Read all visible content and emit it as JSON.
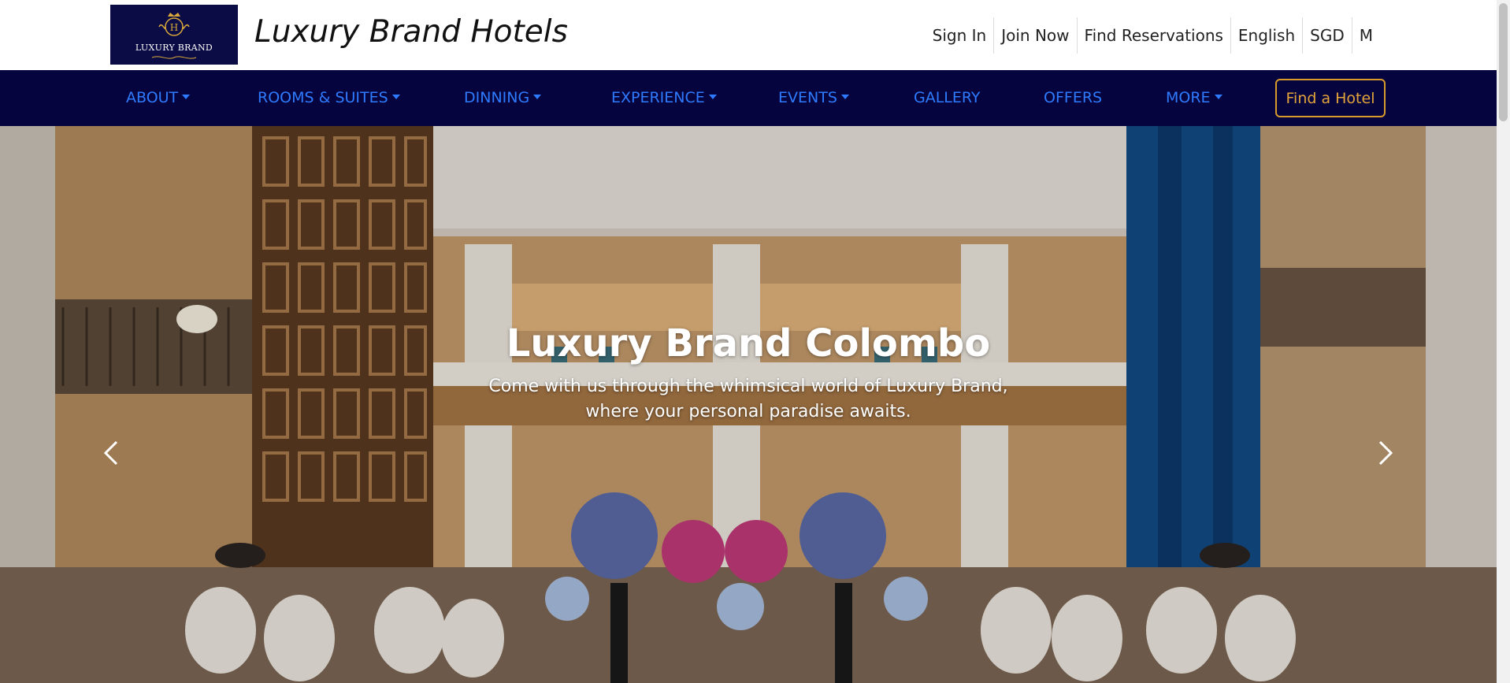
{
  "brand": {
    "logo_text": "LUXURY BRAND",
    "logo_initial": "H",
    "title": "Luxury Brand Hotels",
    "color_navy": "#05043f",
    "color_gold": "#d89b2a"
  },
  "utility_nav": [
    {
      "label": "Sign In"
    },
    {
      "label": "Join Now"
    },
    {
      "label": "Find Reservations"
    },
    {
      "label": "English"
    },
    {
      "label": "SGD"
    },
    {
      "label": "M"
    }
  ],
  "main_nav": [
    {
      "label": "ABOUT",
      "dropdown": true
    },
    {
      "label": "ROOMS & SUITES",
      "dropdown": true
    },
    {
      "label": "DINNING",
      "dropdown": true
    },
    {
      "label": "EXPERIENCE",
      "dropdown": true
    },
    {
      "label": "EVENTS",
      "dropdown": true
    },
    {
      "label": "GALLERY",
      "dropdown": false
    },
    {
      "label": "OFFERS",
      "dropdown": false
    },
    {
      "label": "MORE",
      "dropdown": true
    }
  ],
  "find_hotel_label": "Find a Hotel",
  "hero": {
    "title": "Luxury Brand Colombo",
    "subtitle": "Come with us through the whimsical world of Luxury Brand, where your personal paradise awaits.",
    "prev_icon": "chevron-left-icon",
    "next_icon": "chevron-right-icon"
  }
}
